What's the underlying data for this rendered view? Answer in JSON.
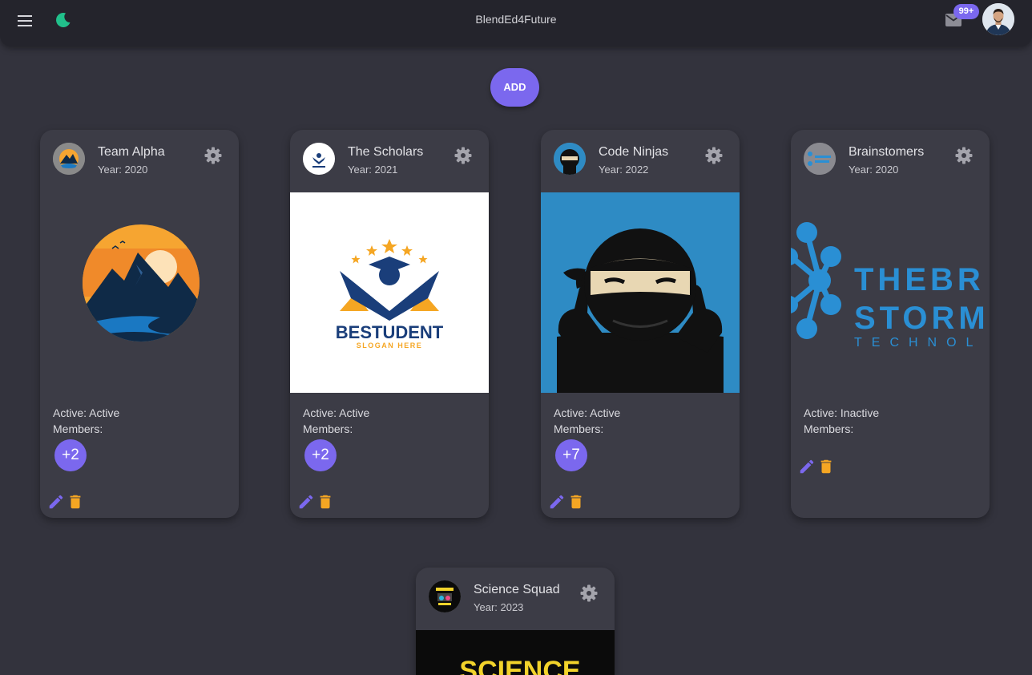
{
  "app": {
    "title": "BlendEd4Future",
    "notification_count": "99+",
    "add_label": "ADD"
  },
  "colors": {
    "accent": "#7b68ee",
    "delete": "#f5a623",
    "moon": "#21c08b",
    "background": "#33333d",
    "card": "#3c3c46"
  },
  "icons": [
    "menu-icon",
    "moon-icon",
    "mail-icon",
    "gear-icon",
    "pencil-icon",
    "trash-icon"
  ],
  "teams": [
    {
      "name": "Team Alpha",
      "year": "Year: 2020",
      "active": "Active: Active",
      "members_label": "Members:",
      "members_extra": "+2"
    },
    {
      "name": "The Scholars",
      "year": "Year: 2021",
      "active": "Active: Active",
      "members_label": "Members:",
      "members_extra": "+2",
      "logo_text": "BESTUDENT",
      "logo_slogan": "SLOGAN HERE"
    },
    {
      "name": "Code Ninjas",
      "year": "Year: 2022",
      "active": "Active: Active",
      "members_label": "Members:",
      "members_extra": "+7"
    },
    {
      "name": "Brainstomers",
      "year": "Year: 2020",
      "active": "Active: Inactive",
      "members_label": "Members:",
      "logo_lines": [
        "THEBR",
        "STORM",
        "TECHNOL"
      ]
    },
    {
      "name": "Science Squad",
      "year": "Year: 2023",
      "logo_text": "SCIENCE"
    }
  ]
}
